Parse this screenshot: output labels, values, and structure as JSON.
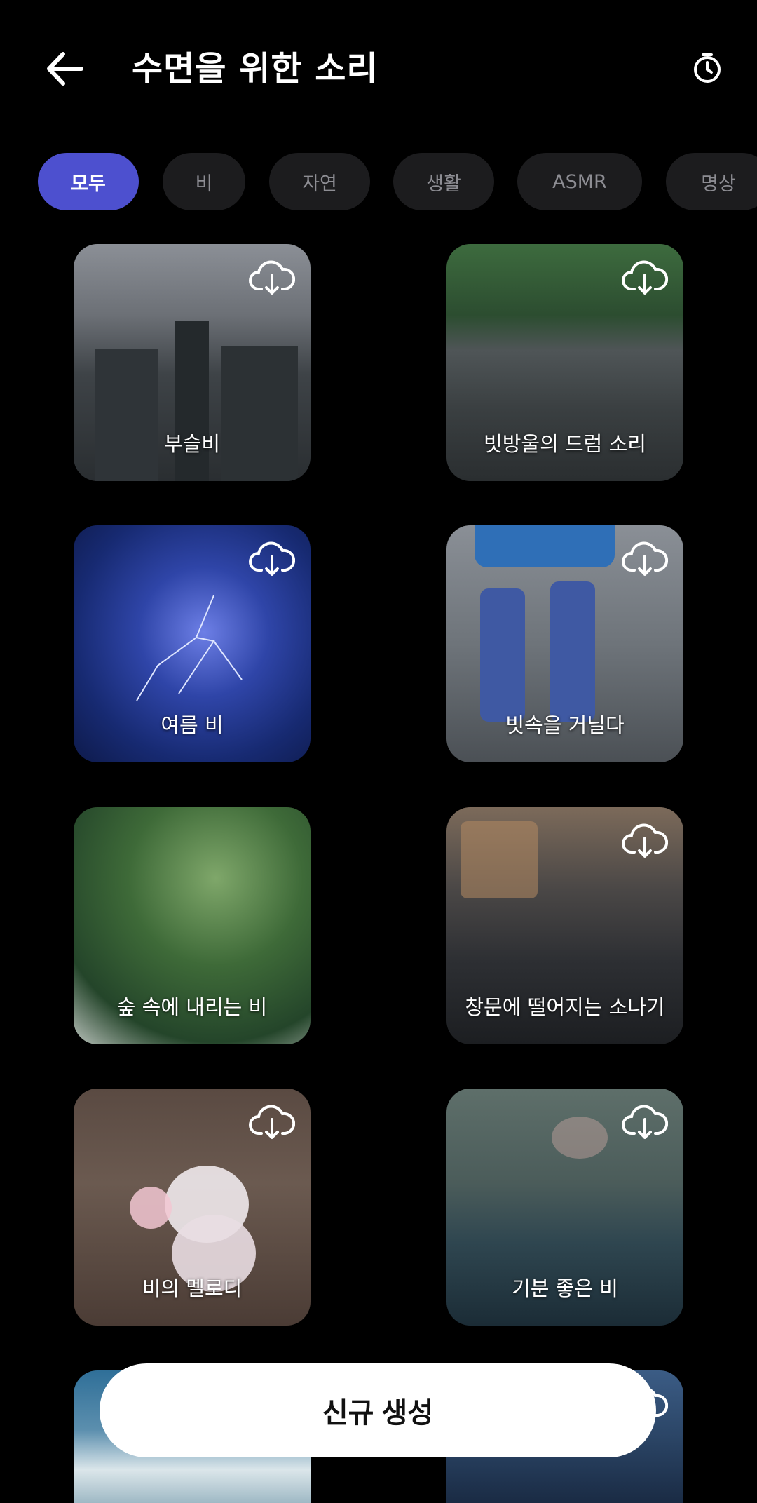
{
  "header": {
    "title": "수면을 위한 소리",
    "back_icon": "arrow-left-icon",
    "timer_icon": "stopwatch-icon"
  },
  "chips": [
    {
      "label": "모두",
      "active": true
    },
    {
      "label": "비",
      "active": false
    },
    {
      "label": "자연",
      "active": false
    },
    {
      "label": "생활",
      "active": false
    },
    {
      "label": "ASMR",
      "active": false
    },
    {
      "label": "명상",
      "active": false
    }
  ],
  "cards": [
    {
      "label": "부슬비",
      "icon": "cloud-download-icon"
    },
    {
      "label": "빗방울의 드럼 소리",
      "icon": "cloud-download-icon"
    },
    {
      "label": "여름 비",
      "icon": "cloud-download-icon"
    },
    {
      "label": "빗속을 거닐다",
      "icon": "cloud-download-icon"
    },
    {
      "label": "숲 속에 내리는 비",
      "icon": "cloud-download-icon"
    },
    {
      "label": "창문에 떨어지는 소나기",
      "icon": "cloud-download-icon"
    },
    {
      "label": "비의 멜로디",
      "icon": "cloud-download-icon"
    },
    {
      "label": "기분 좋은 비",
      "icon": "cloud-download-icon"
    },
    {
      "label": "",
      "icon": ""
    },
    {
      "label": "",
      "icon": "cloud-download-icon"
    }
  ],
  "create_button": {
    "label": "신규 생성"
  },
  "colors": {
    "accent": "#4d50cf",
    "chip_bg": "#1c1c1e",
    "chip_text": "#8d8d93",
    "background": "#000000"
  }
}
